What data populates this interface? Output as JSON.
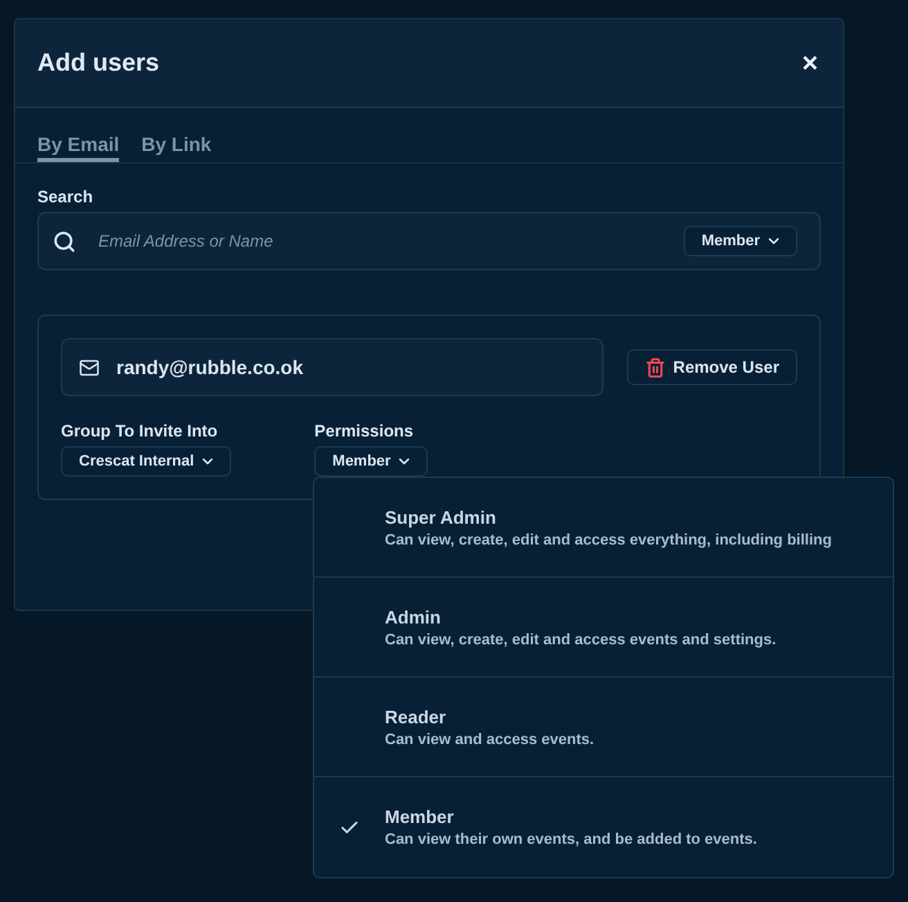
{
  "dialog": {
    "title": "Add users",
    "close": "×"
  },
  "tabs": [
    {
      "label": "By Email",
      "selected": true
    },
    {
      "label": "By Link",
      "selected": false
    }
  ],
  "search": {
    "label": "Search",
    "placeholder": "Email Address or Name",
    "role": "Member"
  },
  "invitee": {
    "email": "randy@rubble.co.ok",
    "remove": "Remove User",
    "group_label": "Group To Invite Into",
    "group": "Crescat Internal",
    "permissions_label": "Permissions",
    "permission": "Member"
  },
  "permission_menu": [
    {
      "name": "Super Admin",
      "description": "Can view, create, edit and access everything, including billing",
      "selected": false
    },
    {
      "name": "Admin",
      "description": "Can view, create, edit and access events and settings.",
      "selected": false
    },
    {
      "name": "Reader",
      "description": "Can view and access events.",
      "selected": false
    },
    {
      "name": "Member",
      "description": "Can view their own events, and be added to events.",
      "selected": true
    }
  ]
}
